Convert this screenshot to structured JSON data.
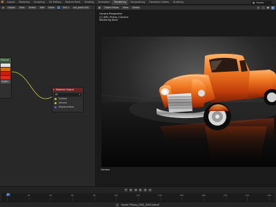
{
  "topbar": {
    "workspaces": [
      "Layout",
      "Modeling",
      "Sculpting",
      "UV Editing",
      "Texture Paint",
      "Shading",
      "Animation",
      "Rendering",
      "Compositing",
      "Geometry Nodes",
      "Scripting"
    ],
    "active_workspace": "Rendering",
    "scene_label": "Scene"
  },
  "node_editor": {
    "header": {
      "editor_mode": "Object",
      "view": "View",
      "select": "Select",
      "add": "Add",
      "node": "Node",
      "slot": "Slot 1",
      "material": "car_paint.001"
    },
    "left_node": {
      "label": "Mixture",
      "swatch_colors": [
        "#e2e2e2",
        "#d96a10",
        "#c81f10",
        "#d92c1a"
      ],
      "field_value": "0.000"
    },
    "output_node": {
      "title": "Material Output",
      "target": "All",
      "sockets": [
        "Surface",
        "Volume",
        "Displacement"
      ]
    }
  },
  "viewport": {
    "header": {
      "mode": "Object Mode",
      "view": "View",
      "shading": "Global"
    },
    "overlay_lines": [
      "Camera Perspective",
      "(1) GMC_Pickup | Camera",
      "Rendering Done"
    ],
    "bottom_label": "Camera"
  },
  "timeline": {
    "ticks": [
      "0",
      "20",
      "40",
      "60",
      "80",
      "100",
      "120",
      "140",
      "160",
      "180",
      "200",
      "220",
      "240"
    ],
    "current_frame": "1"
  },
  "statusbar": {
    "message": "Saved \"Pickup_GMC_0203.blend\""
  },
  "colors": {
    "accent": "#e8832a",
    "paint": "#e0701c",
    "node_output_header": "#6b2424",
    "playhead": "#3d6fd0"
  }
}
